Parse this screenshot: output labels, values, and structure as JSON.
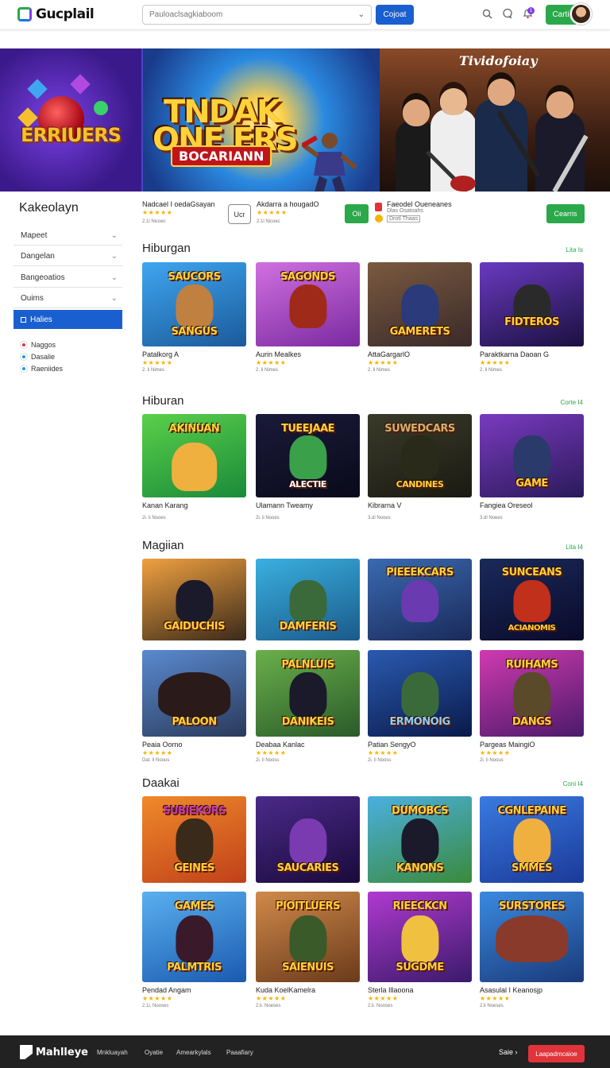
{
  "header": {
    "logo_text": "Gucplail",
    "search_text": "Pauloaclsagkiaboom",
    "search_button": "Cojoat",
    "cart_label": "Carti",
    "notif_count": "1"
  },
  "hero": {
    "left_logo": "ERRIUERS",
    "title_line1": "TNDAK",
    "title_line2": "ONE ERS",
    "title_line3": "BOCARIANN",
    "brand": "Tividofoiay"
  },
  "sidebar": {
    "title": "Kakeolayn",
    "items": [
      {
        "label": "Mapeet"
      },
      {
        "label": "Dangelan"
      },
      {
        "label": "Bangeoatios"
      },
      {
        "label": "Ouims"
      }
    ],
    "active_label": "Halies",
    "legend": [
      {
        "label": "Naggos",
        "color": "#e0343a"
      },
      {
        "label": "Dasalie",
        "color": "#1a9be0"
      },
      {
        "label": "Raeniides",
        "color": "#1a9be0"
      }
    ]
  },
  "featured": {
    "item1_name": "Nadcael I oedaGsayan",
    "item1_meta": "2.1l Nicoec",
    "item1_button": "Ucr",
    "item2_name": "Akdarra a hougadO",
    "item2_meta": "2.1l Nicoec",
    "item2_button": "Oii",
    "item3_name": "Faeodel Oueneanes",
    "item3_sub1": "Dlas Osatoahs",
    "item3_sub2": "Drotl Thaas",
    "button": "Cearris"
  },
  "sections": [
    {
      "title": "Hiburgan",
      "see_all": "Lita Is",
      "cards": [
        {
          "name": "Patalkorg A",
          "meta": "2. li Nimes",
          "art": "SAUCORS",
          "art2": "SANGUS"
        },
        {
          "name": "Aurin Mealkes",
          "meta": "2. li Nimes",
          "art": "SAGONDS"
        },
        {
          "name": "AttaGargarlO",
          "meta": "2. li Nimes",
          "art": "GAMERETS"
        },
        {
          "name": "Paraktkarna Daoan G",
          "meta": "2. li Nimes",
          "art": "FIDTEROS"
        }
      ]
    },
    {
      "title": "Hiburan",
      "see_all": "Corte I4",
      "cards": [
        {
          "name": "Kanan Karang",
          "meta": "2i. li Nooes",
          "art": "AKINUAN"
        },
        {
          "name": "Ulamann Tweamy",
          "meta": "2i. li Nooes",
          "art": "TUEEJAAE",
          "art2": "ALECTIE"
        },
        {
          "name": "Kibrarna V",
          "meta": "3.di Nooes",
          "art": "SUWEDCARS",
          "art2": "CANDINES"
        },
        {
          "name": "Fangiea Oreseol",
          "meta": "3.dl Noees",
          "art": "GAME"
        }
      ]
    },
    {
      "title": "Magiian",
      "see_all": "Lita I4",
      "cards": [
        {
          "name": "",
          "meta": "",
          "art": "GAIDUCHIS"
        },
        {
          "name": "",
          "meta": "",
          "art": "DAMFERIS"
        },
        {
          "name": "",
          "meta": "",
          "art": "PIEEEKCARS"
        },
        {
          "name": "",
          "meta": "",
          "art": "SUNCEANS",
          "art2": "ACIANOMIS"
        },
        {
          "name": "Peaia Oorno",
          "meta": "Dat. li Noous",
          "art": "PALOON"
        },
        {
          "name": "Deabaa Kanlac",
          "meta": "2i. li Nooss",
          "art": "PALNLUIS",
          "art2": "DANIKEIS"
        },
        {
          "name": "Patian SengyO",
          "meta": "2i. li Nooss",
          "art": "ERMONOIG"
        },
        {
          "name": "Pargeas MaingiO",
          "meta": "2i. li Noous",
          "art": "RUIHAMS",
          "art2": "DANGS"
        }
      ]
    },
    {
      "title": "Daakai",
      "see_all": "Coni I4",
      "cards": [
        {
          "name": "",
          "meta": "",
          "art": "SUBIEKORS",
          "art2": "GEINES"
        },
        {
          "name": "",
          "meta": "",
          "art": "SAUCARIES"
        },
        {
          "name": "",
          "meta": "",
          "art": "DUMOBCS",
          "art2": "KANONS"
        },
        {
          "name": "",
          "meta": "",
          "art": "CGNLEPAINE",
          "art2": "SMMES"
        },
        {
          "name": "Pendad Angam",
          "meta": "2.1i. Nooses",
          "art": "GAMES",
          "art2": "PALMTRIS"
        },
        {
          "name": "Kuda KoelKamelra",
          "meta": "2.li. Noeses",
          "art": "PIOITLUERS",
          "art2": "SAIENUIS"
        },
        {
          "name": "Sterla Illaoona",
          "meta": "2.li. Nooses",
          "art": "RIEECKCN",
          "art2": "SUGDME"
        },
        {
          "name": "Asasulal I Keanosjp",
          "meta": "2.li Noeses",
          "art": "SURSTORES"
        }
      ]
    }
  ],
  "footer": {
    "logo": "Mahlleye",
    "links": [
      "Mnkluayah",
      "Oyatie",
      "Amearkylals",
      "Paaafiary"
    ],
    "lang": "Saie",
    "button": "Laapadmcaioe"
  },
  "colors": {
    "primary": "#1a5fd0",
    "accent_green": "#2aa84a",
    "star": "#f4b400",
    "footer_bg": "#222222",
    "footer_btn": "#e0343a"
  }
}
